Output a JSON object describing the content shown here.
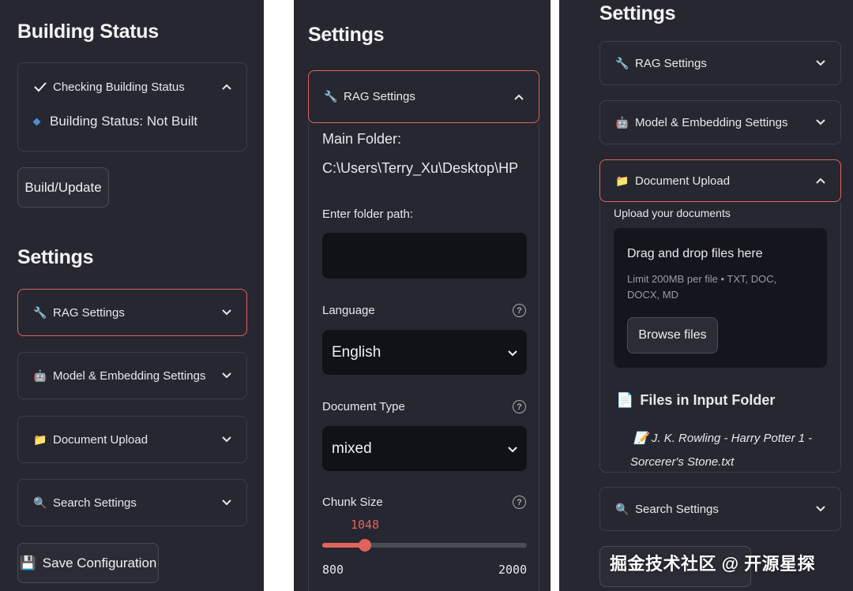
{
  "panel1": {
    "building_heading": "Building Status",
    "status_box": {
      "check_label": "Checking Building Status",
      "status_line": "Building Status: Not Built"
    },
    "build_button": "Build/Update",
    "settings_heading": "Settings",
    "expanders": [
      {
        "label": "RAG Settings",
        "icon": "wrench-icon"
      },
      {
        "label": "Model & Embedding Settings",
        "icon": "robot-icon"
      },
      {
        "label": "Document Upload",
        "icon": "folder-icon"
      },
      {
        "label": "Search Settings",
        "icon": "magnifier-icon"
      }
    ],
    "save_button": "Save Configuration"
  },
  "panel2": {
    "settings_heading": "Settings",
    "rag_expander": {
      "label": "RAG Settings",
      "icon": "wrench-icon"
    },
    "main_folder_label": "Main Folder:",
    "main_folder_path": "C:\\Users\\Terry_Xu\\Desktop\\HP",
    "folder_input": {
      "label": "Enter folder path:",
      "value": ""
    },
    "language": {
      "label": "Language",
      "value": "English"
    },
    "document_type": {
      "label": "Document Type",
      "value": "mixed"
    },
    "chunk_size": {
      "label": "Chunk Size",
      "value": "1048",
      "min": "800",
      "max": "2000",
      "fraction": 0.207
    }
  },
  "panel3": {
    "settings_heading": "Settings",
    "expanders": {
      "rag": {
        "label": "RAG Settings",
        "icon": "wrench-icon"
      },
      "model": {
        "label": "Model & Embedding Settings",
        "icon": "robot-icon"
      },
      "upload": {
        "label": "Document Upload",
        "icon": "folder-icon"
      },
      "search": {
        "label": "Search Settings",
        "icon": "magnifier-icon"
      }
    },
    "upload_label": "Upload your documents",
    "dropzone": {
      "title": "Drag and drop files here",
      "hint": "Limit 200MB per file • TXT, DOC, DOCX, MD",
      "browse": "Browse files"
    },
    "files_heading": "Files in Input Folder",
    "file_item": "J. K. Rowling - Harry Potter 1 - Sorcerer's Stone.txt"
  },
  "watermark": "掘金技术社区 @ 开源星探",
  "colors": {
    "panel_bg": "#262730",
    "accent": "#e0645a",
    "field_bg": "#111218",
    "border": "#3c3e48"
  }
}
